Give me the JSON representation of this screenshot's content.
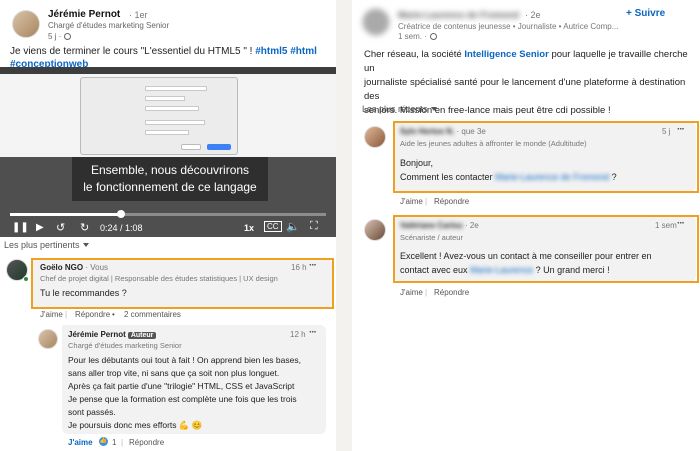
{
  "post": {
    "author_name": "Jérémie Pernot",
    "author_degree": "· 1er",
    "author_headline": "Chargé d'études marketing Senior",
    "time": "5 j ·",
    "text_intro": "Je viens de terminer le cours \"L'essentiel du HTML5 \" ! ",
    "hashtag1": "#html5",
    "hashtag2": "#html",
    "hashtag3": "#conceptionweb"
  },
  "video": {
    "subtitle_line1": "Ensemble, nous découvrirons",
    "subtitle_line2": "le fonctionnement de ce langage",
    "time_display": "0:24 / 1:08",
    "speed": "1x",
    "progress": 0.35
  },
  "left_sort": "Les plus pertinents",
  "comment1": {
    "name": "Goëlo NGO",
    "degree": "· Vous",
    "headline": "Chef de projet digital | Responsable des études statistiques | UX design...",
    "time": "16 h",
    "text": "Tu le recommandes ?",
    "like": "J'aime",
    "reply": "Répondre",
    "replies_count": "2 commentaires"
  },
  "reply1": {
    "name": "Jérémie Pernot",
    "badge": "Auteur",
    "headline": "Chargé d'études marketing Senior",
    "time": "12 h",
    "line1": "Pour les débutants oui tout à fait ! On apprend bien les bases,",
    "line2": "sans aller trop vite, ni sans que ça soit non plus longuet.",
    "line3": "Après ça fait partie d'une \"trilogie\" HTML, CSS et JavaScript",
    "line4": "Je pense que la formation est complète une fois que les trois",
    "line5": "sont passés.",
    "line6": "Je poursuis donc mes efforts 💪 😊",
    "like": "J'aime",
    "like_count": "1",
    "reply": "Répondre"
  },
  "right_post": {
    "author_name": "Marie-Laurence de Fromond",
    "author_degree": "· 2e",
    "author_headline": "Créatrice de contenus jeunesse • Journaliste • Autrice Comp...",
    "time": "1 sem. ·",
    "follow": "+ Suivre",
    "line1_a": "Cher réseau, la société ",
    "line1_link": "Intelligence Senior",
    "line1_b": " pour laquelle je travaille cherche un",
    "line2": "journaliste spécialisé santé pour le lancement d'une plateforme à destination des",
    "line3": "seniors. Mission en free-lance mais peut être cdi possible !"
  },
  "right_sort": "Les plus récents",
  "rcomment1": {
    "name": "Sylv Hertoe N.",
    "degree": "· que 3e",
    "headline": "Aide les jeunes adultes à affronter le monde (Adultitude)",
    "time": "5 j",
    "line1": "Bonjour,",
    "line2_a": "Comment les contacter ",
    "line2_name": "Marie-Laurence de Fromond",
    "line2_b": " ?",
    "like": "J'aime",
    "reply": "Répondre"
  },
  "rcomment2": {
    "name": "Valériane Cariou",
    "degree": "· 2e",
    "headline": "Scénariste / auteur",
    "time": "1 sem",
    "line1": "Excellent ! Avez-vous un contact à me conseiller pour entrer en",
    "line2_a": "contact avec eux ",
    "line2_name": "Marie-Laurence",
    "line2_b": " ? Un grand merci !",
    "like": "J'aime",
    "reply": "Répondre"
  },
  "colors": {
    "link": "#0a66c2",
    "highlight": "#f0a020",
    "comment_bg": "#f2f2f2"
  }
}
